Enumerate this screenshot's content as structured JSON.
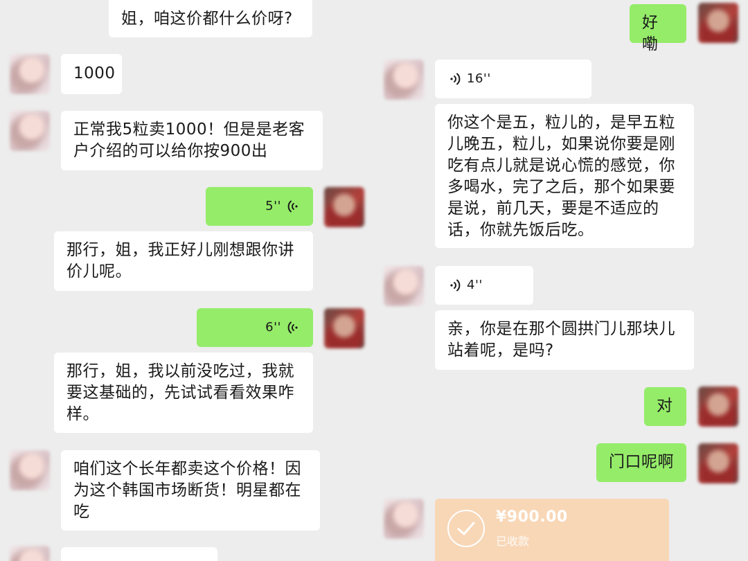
{
  "left": {
    "messages": [
      {
        "text": "姐，咱这价都什么价呀?"
      },
      {
        "text": "1000"
      },
      {
        "text": "正常我5粒卖1000！但是是老客户介绍的可以给你按900出"
      },
      {
        "duration": "5''"
      },
      {
        "text": "那行，姐，我正好儿刚想跟你讲价儿呢。"
      },
      {
        "duration": "6''"
      },
      {
        "text": "那行，姐，我以前没吃过，我就要这基础的，先试试看看效果咋样。"
      },
      {
        "text": "咱们这个长年都卖这个价格！因为这个韩国市场断货！明星都在吃"
      }
    ]
  },
  "right": {
    "messages": [
      {
        "text": "好嘞"
      },
      {
        "duration": "16''"
      },
      {
        "text": "你这个是五，粒儿的，是早五粒儿晚五，粒儿，如果说你要是刚吃有点儿就是说心慌的感觉，你多喝水，完了之后，那个如果要是说，前几天，要是不适应的话，你就先饭后吃。"
      },
      {
        "duration": "4''"
      },
      {
        "text": "亲，你是在那个圆拱门儿那块儿站着呢，是吗?"
      },
      {
        "text": "对"
      },
      {
        "text": "门口呢啊"
      }
    ],
    "payment": {
      "amount": "¥900.00",
      "status": "已收款"
    }
  },
  "colors": {
    "background": "#ededed",
    "incoming_bubble": "#ffffff",
    "outgoing_bubble": "#95ec69",
    "transfer_card": "#f8d7b7"
  },
  "icons": {
    "voice": "voice-wave-icon",
    "transfer": "check-circle-icon"
  }
}
